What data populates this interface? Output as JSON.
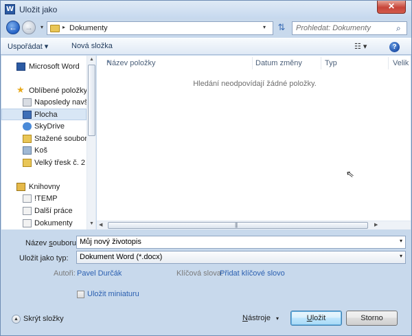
{
  "window": {
    "title": "Uložit jako",
    "app_icon_letter": "W",
    "close_symbol": "✕"
  },
  "nav": {
    "back_symbol": "←",
    "forward_symbol": "→",
    "history_symbol": "▾",
    "breadcrumb_separator": "▸",
    "breadcrumb": "Dokumenty",
    "address_dropdown_symbol": "▾",
    "refresh_symbol": "⇅",
    "search_placeholder": "Prohledat: Dokumenty",
    "search_symbol": "⌕"
  },
  "toolbar": {
    "organize_label": "Uspořádat ▾",
    "new_folder_label": "Nová složka",
    "view_label": "☷ ▾",
    "help_symbol": "?"
  },
  "sidebar": {
    "items": [
      {
        "label": "Microsoft Word",
        "icon": "word-icon"
      },
      {
        "label": "Oblíbené položky",
        "icon": "star-icon"
      },
      {
        "label": "Naposledy navští",
        "icon": "recent-places-icon"
      },
      {
        "label": "Plocha",
        "icon": "desktop-icon"
      },
      {
        "label": "SkyDrive",
        "icon": "skydrive-icon"
      },
      {
        "label": "Stažené soubory",
        "icon": "downloads-icon"
      },
      {
        "label": "Koš",
        "icon": "recycle-bin-icon"
      },
      {
        "label": "Velký třesk č. 2",
        "icon": "folder-icon"
      },
      {
        "label": "Knihovny",
        "icon": "libraries-icon"
      },
      {
        "label": "!TEMP",
        "icon": "document-icon"
      },
      {
        "label": "Další práce",
        "icon": "document-icon"
      },
      {
        "label": "Dokumenty",
        "icon": "document-icon"
      }
    ],
    "scroll_up_symbol": "▲",
    "scroll_down_symbol": "▼"
  },
  "filelist": {
    "columns": [
      "Název položky",
      "Datum změny",
      "Typ",
      "Velik"
    ],
    "sort_symbol": "▲",
    "empty_message": "Hledání neodpovídají žádné položky.",
    "cursor_symbol": "⇖",
    "hscroll_left_symbol": "◀",
    "hscroll_grip": "|||",
    "hscroll_right_symbol": "▶"
  },
  "form": {
    "filename_label_pre": "Název ",
    "filename_label_key": "s",
    "filename_label_post": "ouboru:",
    "filename_value": "Můj nový životopis",
    "filetype_label_pre": "Uložit ",
    "filetype_label_key": "j",
    "filetype_label_post": "ako typ:",
    "filetype_value": "Dokument Word (*.docx)",
    "dropdown_symbol": "▾",
    "authors_label": "Autoři:",
    "authors_value": "Pavel Durčák",
    "tags_label": "Klíčová slova:",
    "tags_value": "Přidat klíčové slovo",
    "thumbnail_label": "Uložit miniaturu"
  },
  "footer": {
    "collapse_symbol": "▲",
    "hide_folders_label": "Skrýt složky",
    "tools_label_key": "N",
    "tools_label_post": "ástroje",
    "tools_dropdown_symbol": "▾",
    "save_label_key": "U",
    "save_label_post": "ložit",
    "cancel_label": "Storno"
  }
}
